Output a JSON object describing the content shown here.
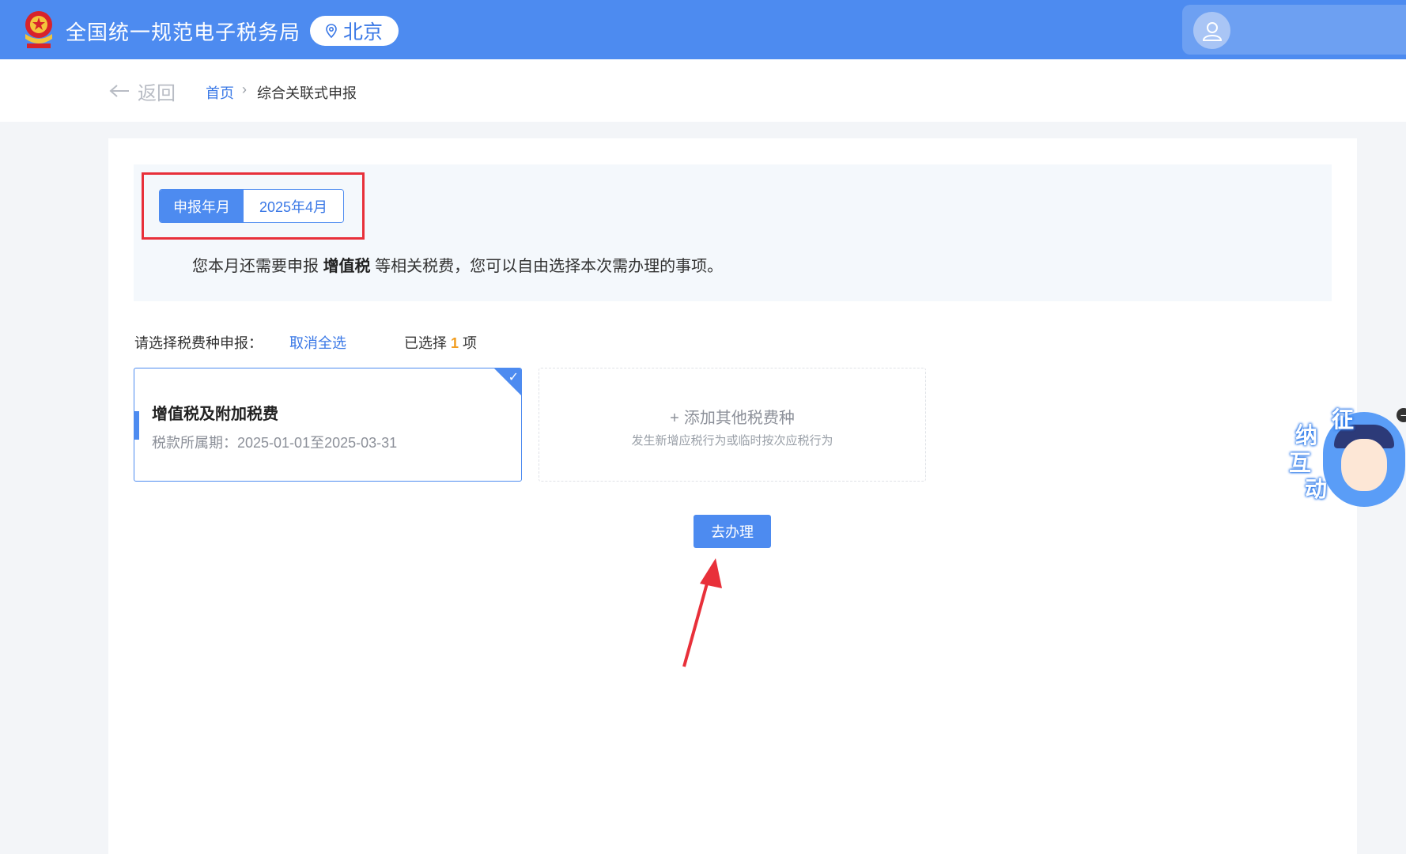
{
  "header": {
    "site_title": "全国统一规范电子税务局",
    "city": "北京",
    "user_name": "",
    "emblem_icon": "tax-emblem-icon",
    "location_icon": "location-pin-icon",
    "user_icon": "user-icon"
  },
  "breadcrumb": {
    "back_label": "返回",
    "home": "首页",
    "separator": "›",
    "current": "综合关联式申报"
  },
  "period": {
    "label": "申报年月",
    "value": "2025年4月"
  },
  "notice": {
    "prefix": "您本月还需要申报",
    "tax": "增值税",
    "suffix": "等相关税费，您可以自由选择本次需办理的事项。"
  },
  "selection": {
    "prompt": "请选择税费种申报：",
    "deselect_all": "取消全选",
    "selected_prefix": "已选择",
    "selected_count": "1",
    "selected_suffix": "项"
  },
  "tax_cards": [
    {
      "name": "增值税及附加税费",
      "period": "税款所属期：2025-01-01至2025-03-31",
      "selected": true
    }
  ],
  "add_card": {
    "title": "添加其他税费种",
    "subtitle": "发生新增应税行为或临时按次应税行为"
  },
  "actions": {
    "go_label": "去办理"
  },
  "assistant": {
    "chars": [
      "征",
      "纳",
      "互",
      "动"
    ]
  },
  "colors": {
    "primary": "#4d8bf0",
    "link": "#3a78e6",
    "highlight_red": "#e8303a",
    "count_orange": "#f29d1f"
  }
}
